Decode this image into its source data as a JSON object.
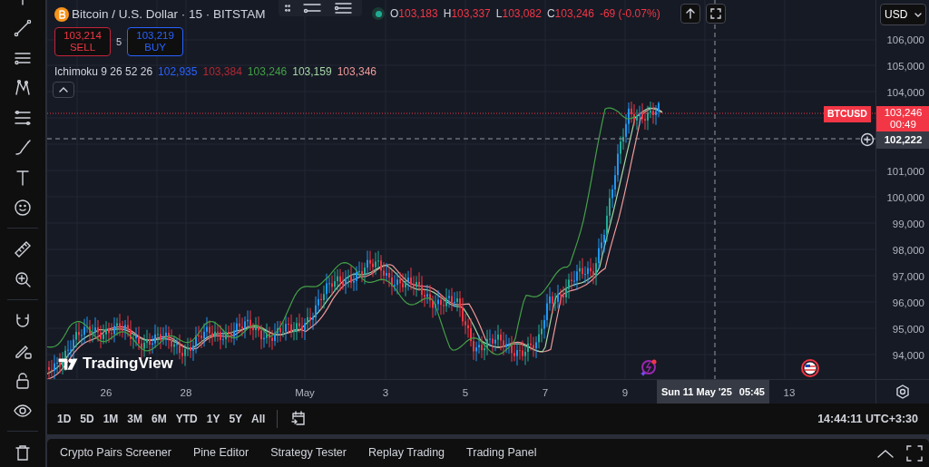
{
  "legend": {
    "title": "Bitcoin / U.S. Dollar · 15 · BITSTAM",
    "sell": {
      "price": "103,214",
      "label": "SELL"
    },
    "spread": "5",
    "buy": {
      "price": "103,219",
      "label": "BUY"
    },
    "ohlc": [
      {
        "key": "O",
        "value": "103,183"
      },
      {
        "key": "H",
        "value": "103,337"
      },
      {
        "key": "L",
        "value": "103,082"
      },
      {
        "key": "C",
        "value": "103,246"
      }
    ],
    "change": "-69 (-0.07%)"
  },
  "indicator": {
    "name": "Ichimoku 9 26 52 26",
    "values": [
      {
        "text": "102,935",
        "color": "#2962ff"
      },
      {
        "text": "103,384",
        "color": "#b22833"
      },
      {
        "text": "103,246",
        "color": "#43a047"
      },
      {
        "text": "103,159",
        "color": "#a5d6a7"
      },
      {
        "text": "103,346",
        "color": "#ef9a9a"
      }
    ]
  },
  "currency": "USD",
  "price_axis_upper": [
    "106,000",
    "105,000",
    "104,000"
  ],
  "price_axis_lower": [
    "101,000",
    "100,000",
    "99,000",
    "98,000",
    "97,000",
    "96,000",
    "95,000",
    "94,000"
  ],
  "last_price": {
    "symbol": "BTCUSD",
    "price": "103,246",
    "countdown": "00:49"
  },
  "crosshair": {
    "price": "102,222",
    "date": "Sun 11 May '25",
    "time": "05:45"
  },
  "time_axis": [
    "26",
    "28",
    "May",
    "3",
    "5",
    "7",
    "9",
    "13"
  ],
  "logo": "TradingView",
  "ranges": [
    "1D",
    "5D",
    "1M",
    "3M",
    "6M",
    "YTD",
    "1Y",
    "5Y",
    "All"
  ],
  "clock": "14:44:11 UTC+3:30",
  "bottom_tabs": [
    "Crypto Pairs Screener",
    "Pine Editor",
    "Strategy Tester",
    "Replay Trading",
    "Trading Panel"
  ]
}
